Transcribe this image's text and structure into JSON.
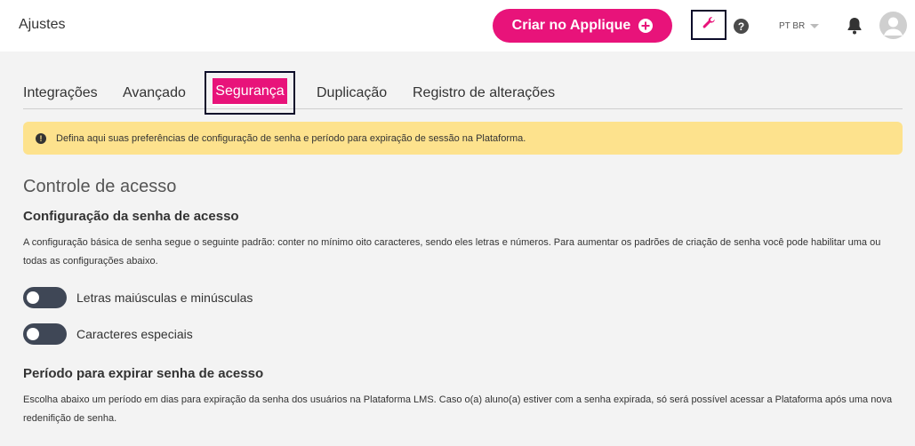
{
  "header": {
    "title": "Ajustes",
    "cta_label": "Criar no Applique",
    "language": "PT BR"
  },
  "tabs": [
    {
      "label": "Integrações",
      "active": false
    },
    {
      "label": "Avançado",
      "active": false
    },
    {
      "label": "Segurança",
      "active": true
    },
    {
      "label": "Duplicação",
      "active": false
    },
    {
      "label": "Registro de alterações",
      "active": false
    }
  ],
  "alert": {
    "text": "Defina aqui suas preferências de configuração de senha e período para expiração de sessão na Plataforma."
  },
  "section": {
    "title": "Controle de acesso",
    "password_config": {
      "title": "Configuração da senha de acesso",
      "description": "A configuração básica de senha segue o seguinte padrão: conter no mínimo oito caracteres, sendo eles letras e números. Para aumentar os padrões de criação de senha você pode habilitar uma ou todas as configurações abaixo.",
      "toggles": [
        {
          "label": "Letras maiúsculas e minúsculas",
          "enabled": false
        },
        {
          "label": "Caracteres especiais",
          "enabled": false
        }
      ]
    },
    "expiration": {
      "title": "Período para expirar senha de acesso",
      "description": "Escolha abaixo um período em dias para expiração da senha dos usuários na Plataforma LMS. Caso o(a) aluno(a) estiver com a senha expirada, só será possível acessar a Plataforma após uma nova redenifição de senha."
    }
  },
  "colors": {
    "accent": "#e8137a",
    "alert_bg": "#fde28d",
    "toggle_off": "#3f4756",
    "content_bg": "#f3f3f3"
  },
  "icons": [
    "plus-circle-icon",
    "wrench-icon",
    "help-icon",
    "caret-down-icon",
    "bell-icon",
    "user-avatar-icon",
    "exclamation-icon"
  ]
}
